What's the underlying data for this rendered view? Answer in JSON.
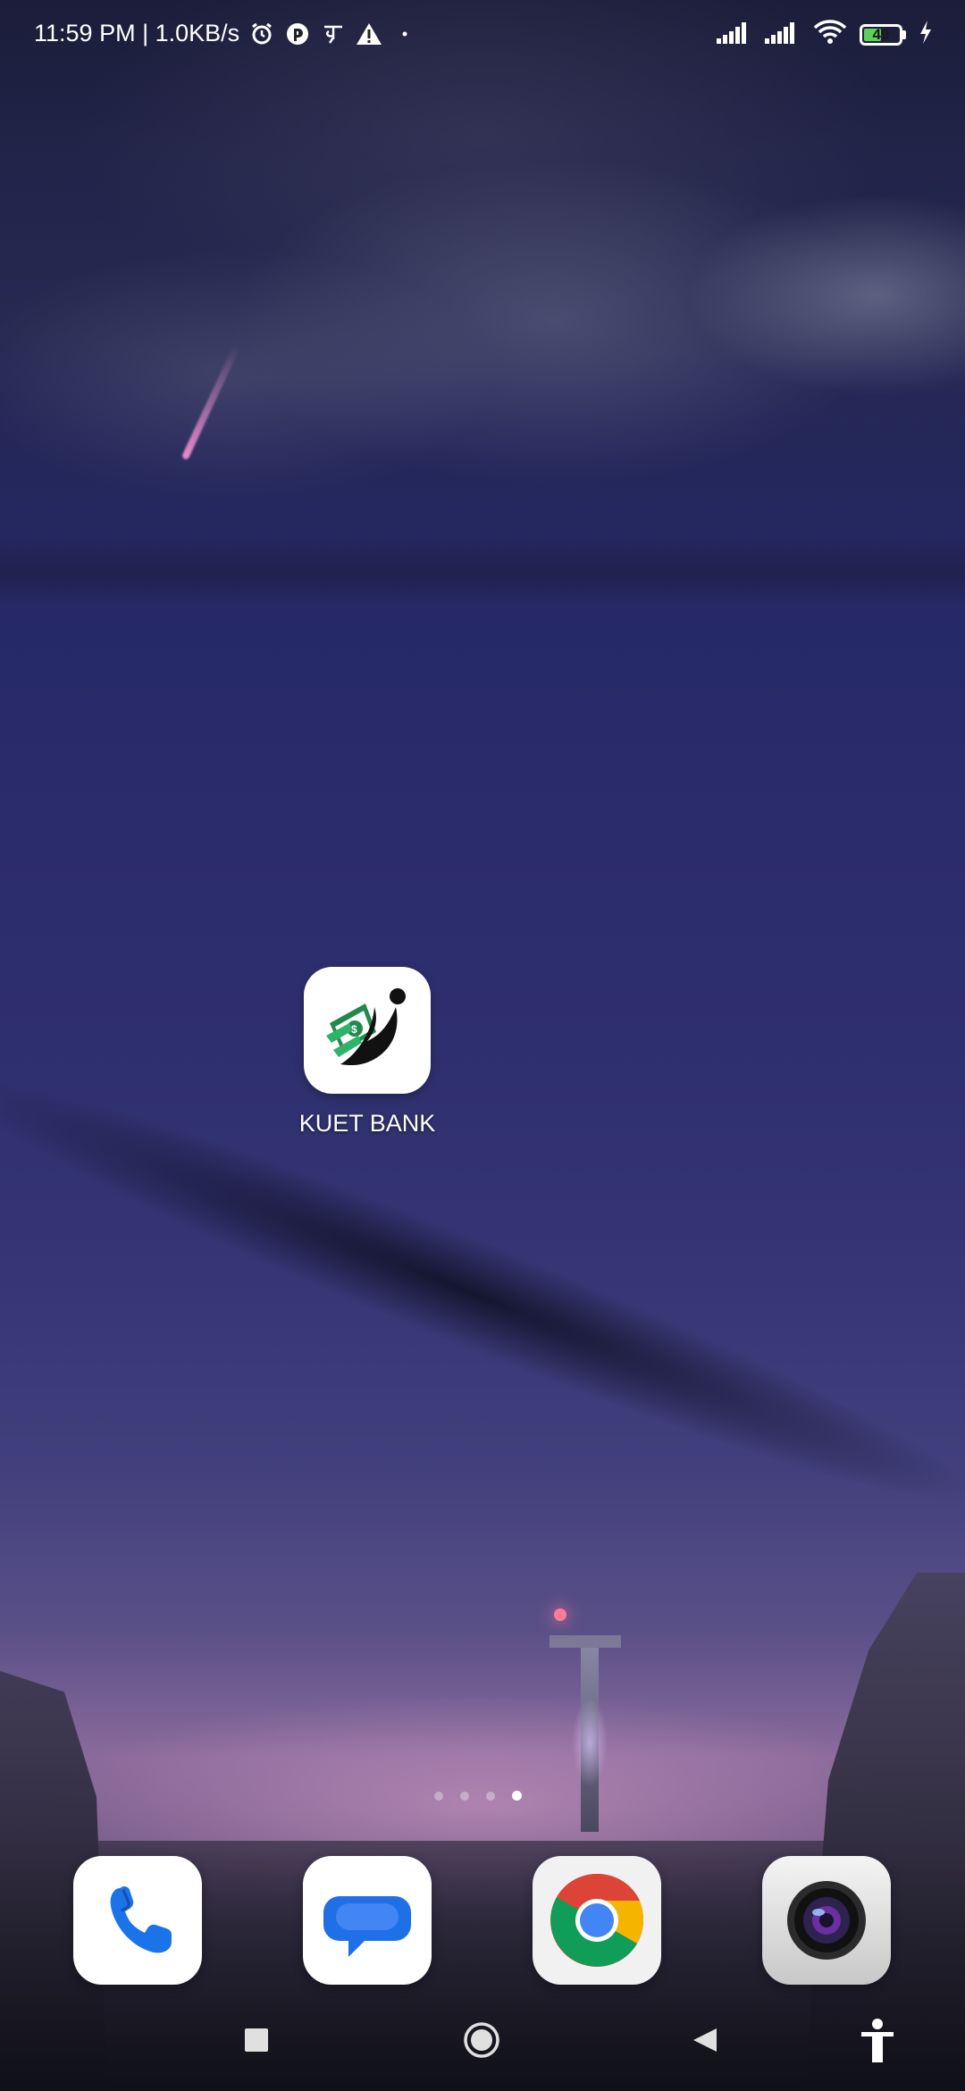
{
  "status_bar": {
    "time_speed": "11:59 PM | 1.0KB/s",
    "battery_level": "49",
    "icons_left": [
      "alarm-icon",
      "app-notification-icon",
      "bangla-char-icon",
      "warning-icon",
      "dot-icon"
    ],
    "icons_right": [
      "signal-1-icon",
      "signal-2-icon",
      "wifi-icon",
      "battery-icon",
      "charging-icon"
    ]
  },
  "home": {
    "apps": [
      {
        "label": "KUET BANK",
        "icon": "kuet-bank-logo-icon"
      }
    ]
  },
  "page_indicator": {
    "count": 4,
    "active_index": 3
  },
  "dock": [
    {
      "name": "Phone",
      "icon": "phone-icon"
    },
    {
      "name": "Messages",
      "icon": "messages-icon"
    },
    {
      "name": "Chrome",
      "icon": "chrome-icon"
    },
    {
      "name": "Camera",
      "icon": "camera-icon"
    }
  ],
  "nav_bar": {
    "buttons": [
      "recents-square-icon",
      "home-circle-icon",
      "back-triangle-icon",
      "accessibility-icon"
    ]
  },
  "colors": {
    "accent_green": "#5fd15a",
    "phone_blue": "#1a73e8",
    "messages_blue": "#1f6fe6"
  }
}
